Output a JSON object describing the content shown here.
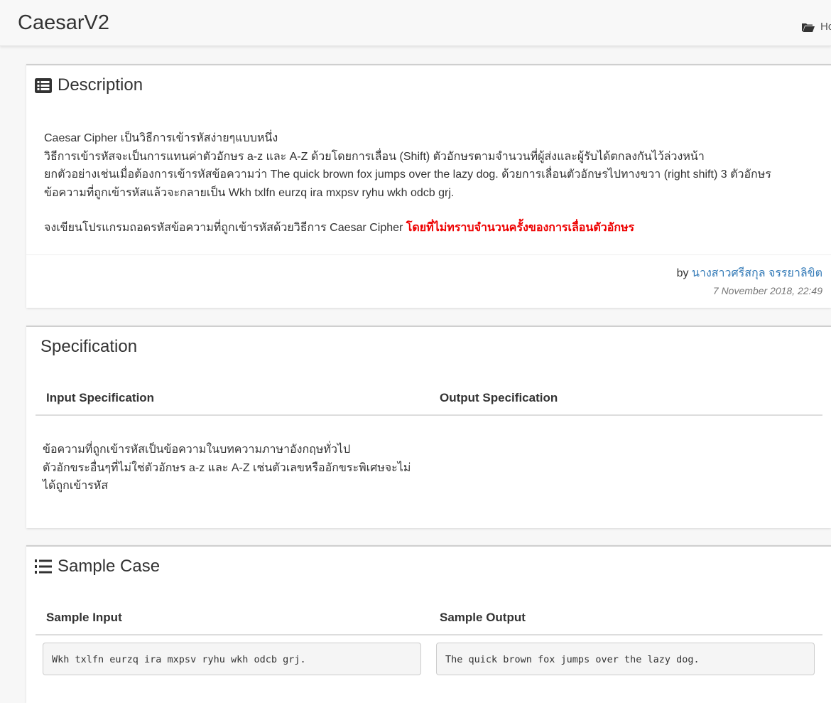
{
  "navbar": {
    "brand": "CaesarV2",
    "home_label": "Ho",
    "home_icon": "folder-open-icon"
  },
  "description": {
    "title": "Description",
    "icon": "list-alt-icon",
    "lines": [
      "Caesar Cipher เป็นวิธีการเข้ารหัสง่ายๆแบบหนึ่ง",
      "วิธีการเข้ารหัสจะเป็นการแทนค่าตัวอักษร a-z และ A-Z ด้วยโดยการเลื่อน (Shift) ตัวอักษรตามจำนวนที่ผู้ส่งและผู้รับได้ตกลงกันไว้ล่วงหน้า",
      "ยกตัวอย่างเช่นเมื่อต้องการเข้ารหัสข้อความว่า The quick brown fox jumps over the lazy dog. ด้วยการเลื่อนตัวอักษรไปทางขวา (right shift) 3 ตัวอักษร",
      "ข้อความที่ถูกเข้ารหัสแล้วจะกลายเป็น Wkh txlfn eurzq ira mxpsv ryhu wkh odcb grj."
    ],
    "task_prefix": "จงเขียนโปรแกรมถอดรหัสข้อความที่ถูกเข้ารหัสด้วยวิธีการ Caesar Cipher ",
    "task_warning": "โดยที่ไม่ทราบจำนวนครั้งของการเลื่อนตัวอักษร",
    "warning_color": "#ee0000",
    "by_label": "by",
    "author": "นางสาวศรีสกุล จรรยาลิขิต",
    "author_color": "#337ab7",
    "date": "7 November 2018, 22:49"
  },
  "specification": {
    "title": "Specification",
    "input_header": "Input Specification",
    "output_header": "Output Specification",
    "input_lines": [
      "ข้อความที่ถูกเข้ารหัสเป็นข้อความในบทความภาษาอังกฤษทั่วไป",
      "ตัวอักขระอื่นๆที่ไม่ใช่ตัวอักษร a-z และ A-Z เช่นตัวเลขหรืออักขระพิเศษจะไม่ได้ถูกเข้ารหัส"
    ]
  },
  "sample": {
    "title": "Sample Case",
    "icon": "list-ol-icon",
    "input_header": "Sample Input",
    "output_header": "Sample Output",
    "input_value": "Wkh txlfn eurzq ira mxpsv ryhu wkh odcb grj.",
    "output_value": "The quick brown fox jumps over the lazy dog."
  }
}
